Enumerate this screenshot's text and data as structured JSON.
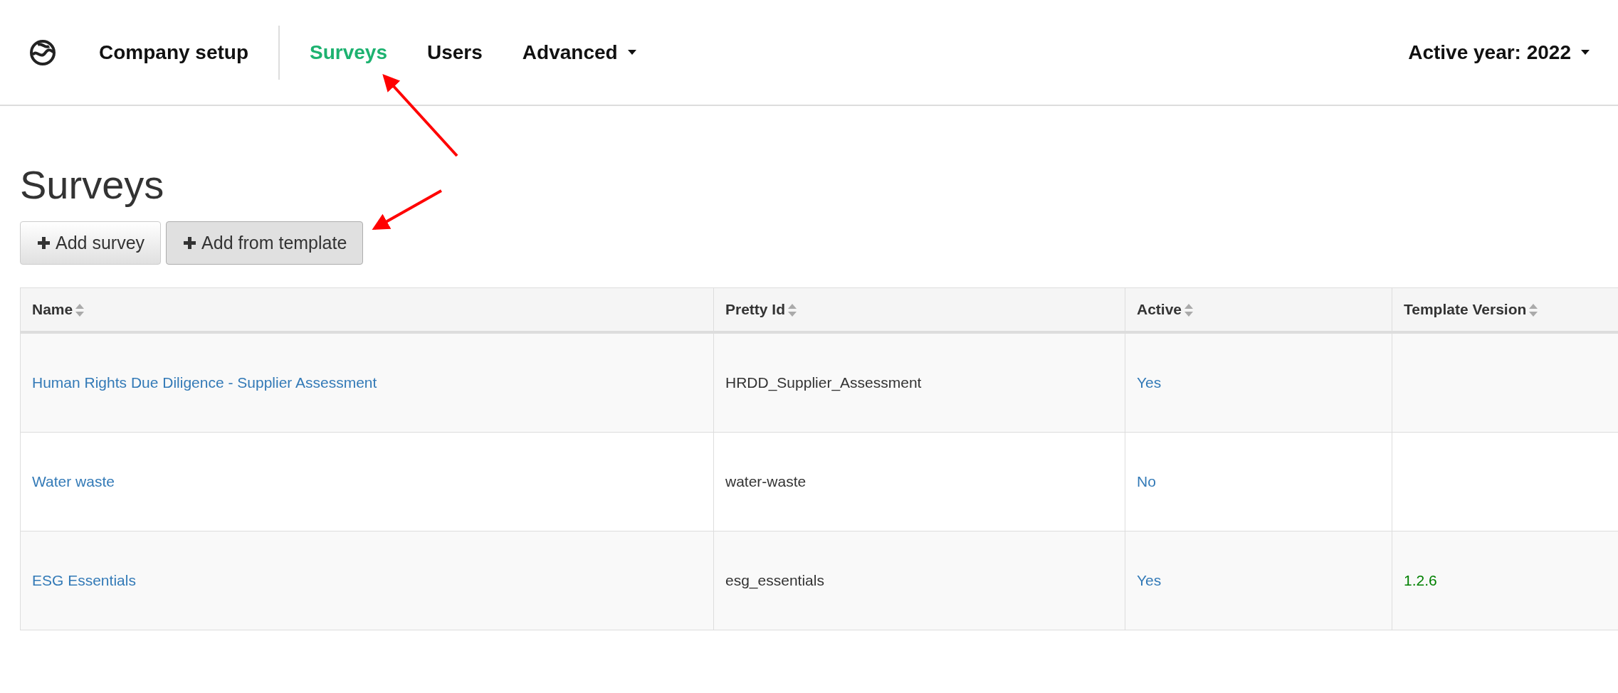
{
  "nav": {
    "items": [
      {
        "label": "Company setup",
        "selected": false,
        "dropdown": false
      },
      {
        "label": "Surveys",
        "selected": true,
        "dropdown": false
      },
      {
        "label": "Users",
        "selected": false,
        "dropdown": false
      },
      {
        "label": "Advanced",
        "selected": false,
        "dropdown": true
      }
    ],
    "year_menu": "Active year: 2022"
  },
  "page_title": "Surveys",
  "buttons": [
    "Add survey",
    "Add from template"
  ],
  "table": {
    "columns": [
      "Name",
      "Pretty Id",
      "Active",
      "Template Version"
    ],
    "rows": [
      {
        "name": "Human Rights Due Diligence - Supplier Assessment",
        "pretty_id": "HRDD_Supplier_Assessment",
        "active": "Yes"
      },
      {
        "name": "Water waste",
        "pretty_id": "water-waste",
        "active": "No"
      },
      {
        "name": "ESG Essentials",
        "pretty_id": "esg_essentials",
        "active": "Yes",
        "template_version": "1.2.6"
      }
    ]
  }
}
